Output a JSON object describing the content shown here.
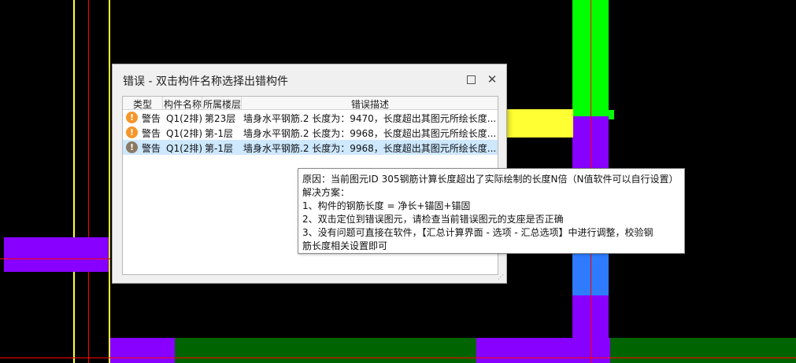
{
  "dialog": {
    "title": "错误 - 双击构件名称选择出错构件",
    "maximize_icon": "maximize-icon",
    "close_icon": "close-icon",
    "close_glyph": "✕",
    "columns": [
      "类型",
      "构件名称",
      "所属楼层",
      "错误描述"
    ],
    "rows": [
      {
        "type": "警告",
        "name": "Q1(2排)",
        "floor": "第23层",
        "desc": "墙身水平钢筋.2 长度为：9470，长度超出其图元所绘长度...",
        "icon": "warning-icon",
        "selected": false
      },
      {
        "type": "警告",
        "name": "Q1(2排)",
        "floor": "第-1层",
        "desc": "墙身水平钢筋.2 长度为：9968，长度超出其图元所绘长度...",
        "icon": "warning-icon",
        "selected": false
      },
      {
        "type": "警告",
        "name": "Q1(2排)",
        "floor": "第-1层",
        "desc": "墙身水平钢筋.2 长度为：9968，长度超出其图元所绘长度...",
        "icon": "warning-icon",
        "selected": true
      }
    ],
    "warn_glyph": "!"
  },
  "tooltip": {
    "lines": [
      "原因：当前图元ID 305钢筋计算长度超出了实际绘制的长度N倍（N值软件可以自行设置）",
      "解决方案：",
      "1、构件的钢筋长度 = 净长+锚固+锚固",
      "2、双击定位到错误图元，请检查当前错误图元的支座是否正确",
      "3、没有问题可直接在软件，【汇总计算界面 - 选项 - 汇总选项】中进行调整，校验钢",
      "筋长度相关设置即可"
    ]
  },
  "colors": {
    "background": "#000000",
    "wall_yellow": "#ffff33",
    "wall_purple": "#8800ff",
    "wall_green": "#00ff00",
    "wall_blue": "#2f7bff",
    "slab_dark_green": "#006400",
    "axis_red": "#ff0000",
    "selected_row": "#cde8ff",
    "warning_orange": "#f5962a"
  }
}
